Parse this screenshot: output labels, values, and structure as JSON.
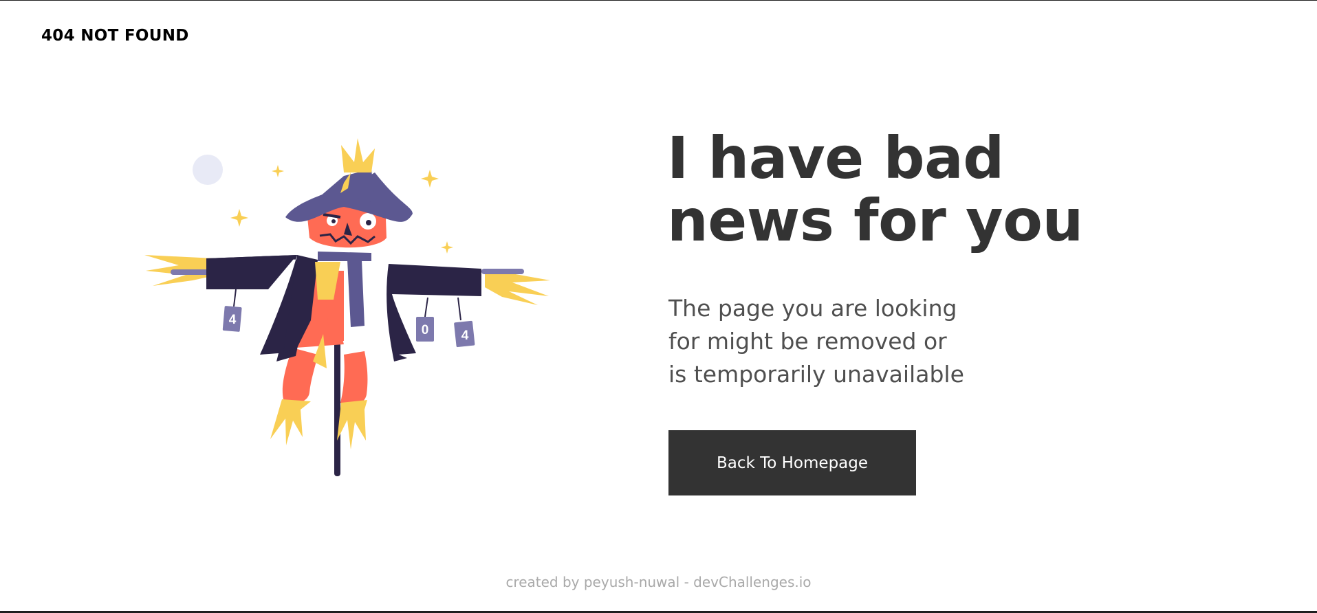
{
  "header": {
    "brand": "404 NOT FOUND"
  },
  "illustration": {
    "subject": "scarecrow",
    "can_labels": [
      "4",
      "0",
      "4"
    ]
  },
  "main": {
    "headline": "I have bad news for you",
    "message": "The page you are looking for might be removed or is temporarily unavailable",
    "button_label": "Back To Homepage"
  },
  "footer": {
    "credit": "created by peyush-nuwal - devChallenges.io"
  },
  "colors": {
    "text_dark": "#333333",
    "text_muted": "#4f4f4f",
    "footer_text": "#a9a9a9",
    "button_bg": "#333333",
    "coat": "#2b2446",
    "hat": "#5c5891",
    "pumpkin": "#ff6b54",
    "straw": "#f9cf55",
    "can": "#7d79ad"
  }
}
